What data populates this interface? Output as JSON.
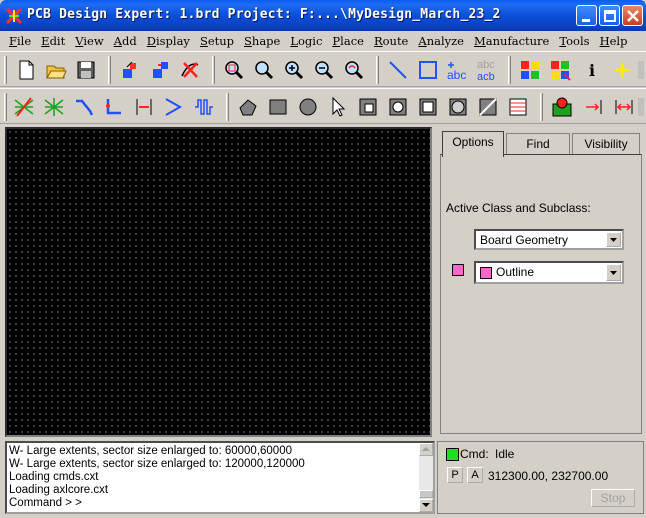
{
  "window": {
    "title": "PCB Design Expert: 1.brd  Project: F:...\\MyDesign_March_23_2"
  },
  "menu": [
    "File",
    "Edit",
    "View",
    "Add",
    "Display",
    "Setup",
    "Shape",
    "Logic",
    "Place",
    "Route",
    "Analyze",
    "Manufacture",
    "Tools",
    "Help"
  ],
  "toolbar1": {
    "text_tool_label": "abc",
    "text_rename_top": "abc",
    "text_rename_bottom": "acb",
    "info_glyph": "i"
  },
  "panel": {
    "tabs": [
      "Options",
      "Find",
      "Visibility"
    ],
    "active_class_label": "Active Class and Subclass:",
    "class_value": "Board Geometry",
    "subclass_value": "Outline",
    "subclass_color": "#ff66cc"
  },
  "console": {
    "lines": [
      "W- Large extents, sector size enlarged to: 60000,60000",
      "W- Large extents, sector size enlarged to: 120000,120000",
      "Loading cmds.cxt",
      "Loading axlcore.cxt",
      "Command > >"
    ]
  },
  "status": {
    "cmd_label": "Cmd:",
    "cmd_value": "Idle",
    "p_button": "P",
    "a_button": "A",
    "coordinates": "312300.00, 232700.00",
    "stop_label": "Stop",
    "indicator_color": "#22dd22"
  },
  "colors": {
    "titlebar": "#0a4fd8",
    "canvas_bg": "#000000",
    "chrome": "#d4d0c8"
  }
}
